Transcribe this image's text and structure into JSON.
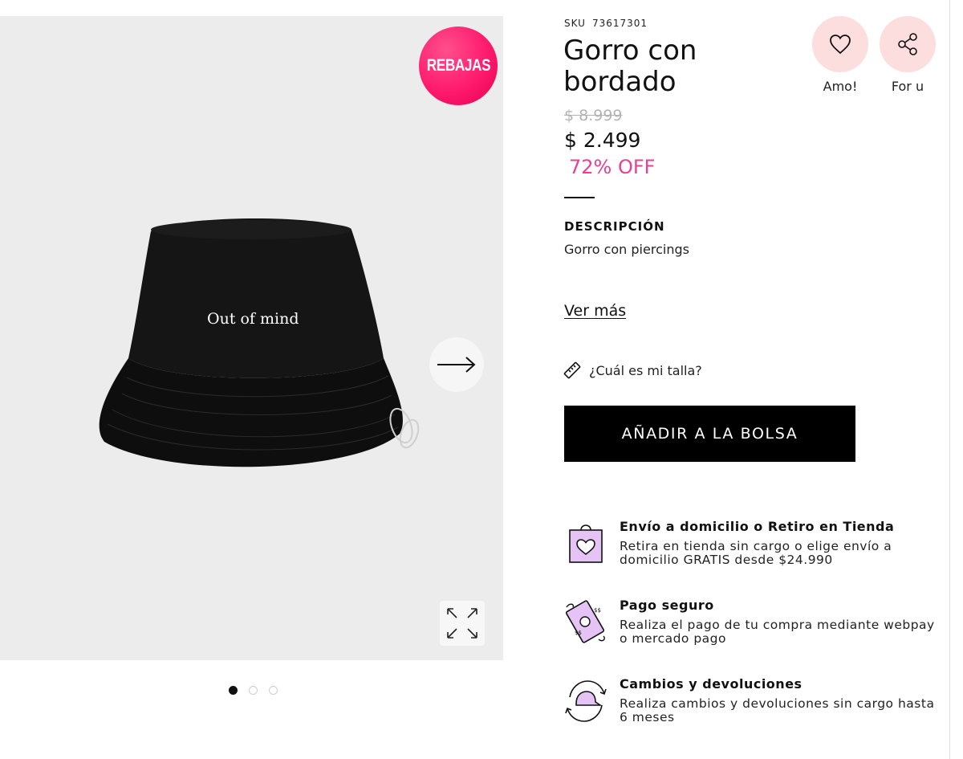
{
  "gallery": {
    "sale_badge": "REBAJAS",
    "hat_embroidery": "Out of mind",
    "pagination": {
      "total": 3,
      "active": 0
    }
  },
  "product": {
    "sku_label": "SKU",
    "sku": "73617301",
    "title": "Gorro con bordado",
    "price_old": "$ 8.999",
    "price_new": "$ 2.499",
    "discount": "72% OFF"
  },
  "actions": {
    "favorite_label": "Amo!",
    "share_label": "For u"
  },
  "description": {
    "title": "DESCRIPCIÓN",
    "text": "Gorro con piercings",
    "see_more": "Ver más"
  },
  "size_guide": "¿Cuál es mi talla?",
  "add_to_bag": "AÑADIR A LA BOLSA",
  "features": [
    {
      "icon": "shopping-bag-heart-icon",
      "title": "Envío a domicilio o Retiro en Tienda",
      "text": "Retira en tienda sin cargo o elige envío a domicilio GRATIS desde $24.990"
    },
    {
      "icon": "money-bills-icon",
      "title": "Pago seguro",
      "text": "Realiza el pago de tu compra mediante webpay o mercado pago"
    },
    {
      "icon": "cap-exchange-icon",
      "title": "Cambios y devoluciones",
      "text": "Realiza cambios y devoluciones sin cargo hasta 6 meses"
    }
  ],
  "colors": {
    "sale_badge": "#ff1a6e",
    "discount": "#ea3f93",
    "action_circle": "#fbdedd",
    "feature_icon_fill": "#e5c4f5",
    "gallery_bg": "#ececed"
  }
}
